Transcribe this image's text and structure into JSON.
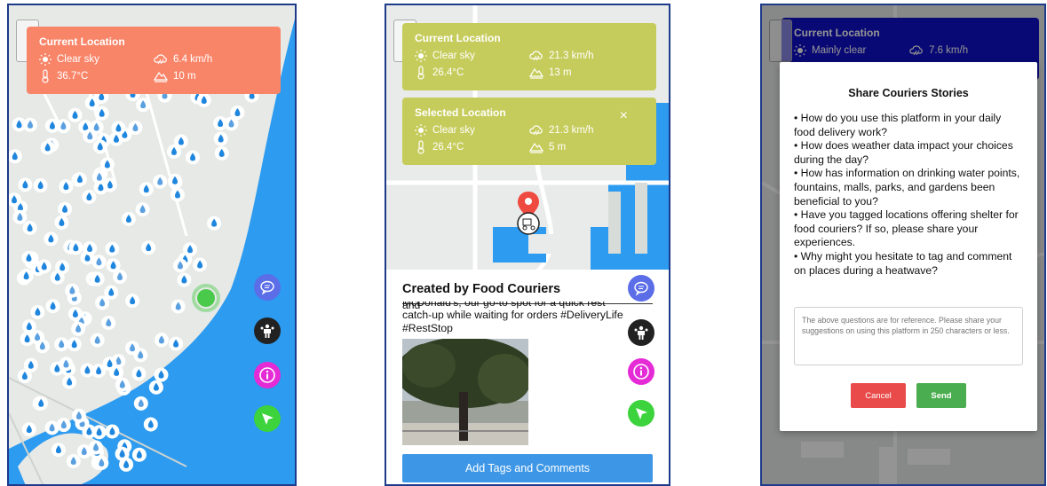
{
  "colors": {
    "card_orange": "#f98569",
    "card_olive": "#c6cc5b",
    "card_blue": "#1111cc",
    "sea": "#2c9bf0",
    "send": "#4aad4f",
    "cancel": "#e94b4b",
    "add_button": "#3e97e6"
  },
  "icons": [
    "sun-icon",
    "thermometer-icon",
    "wind-icon",
    "altitude-icon",
    "chat-icon",
    "people-icon",
    "info-icon",
    "navigate-icon",
    "close-icon",
    "location-pin-icon",
    "water-drop-icon",
    "fountain-icon"
  ],
  "screen1": {
    "card": {
      "title": "Current Location",
      "sky": "Clear sky",
      "wind": "6.4 km/h",
      "temp": "36.7°C",
      "altitude": "10 m"
    }
  },
  "screen2": {
    "current": {
      "title": "Current Location",
      "sky": "Clear sky",
      "wind": "21.3 km/h",
      "temp": "26.4°C",
      "altitude": "13 m"
    },
    "selected": {
      "title": "Selected Location",
      "sky": "Clear sky",
      "wind": "21.3 km/h",
      "temp": "26.4°C",
      "altitude": "5 m",
      "close": "×"
    },
    "sheet": {
      "title": "Created by Food Couriers",
      "post_line1": "McDonald's, our go-to spot for a quick rest and",
      "post_line2": "catch-up while waiting for orders #DeliveryLife",
      "post_line3": "#RestStop",
      "button": "Add Tags and Comments"
    }
  },
  "screen3": {
    "card": {
      "title": "Current Location",
      "sky": "Mainly clear",
      "wind": "7.6 km/h"
    },
    "modal": {
      "title": "Share Couriers Stories",
      "questions": [
        "• How do you use this platform in your daily food delivery work?",
        "• How does weather data impact your choices during the day?",
        "• How has information on drinking water points, fountains, malls, parks, and gardens been beneficial to you?",
        "• Have you tagged locations offering shelter for food couriers? If so, please share your experiences.",
        "• Why might you hesitate to tag and comment on places during a heatwave?"
      ],
      "placeholder": "The above questions are for reference. Please share your suggestions on using this platform in 250 characters or less.",
      "cancel": "Cancel",
      "send": "Send"
    }
  }
}
